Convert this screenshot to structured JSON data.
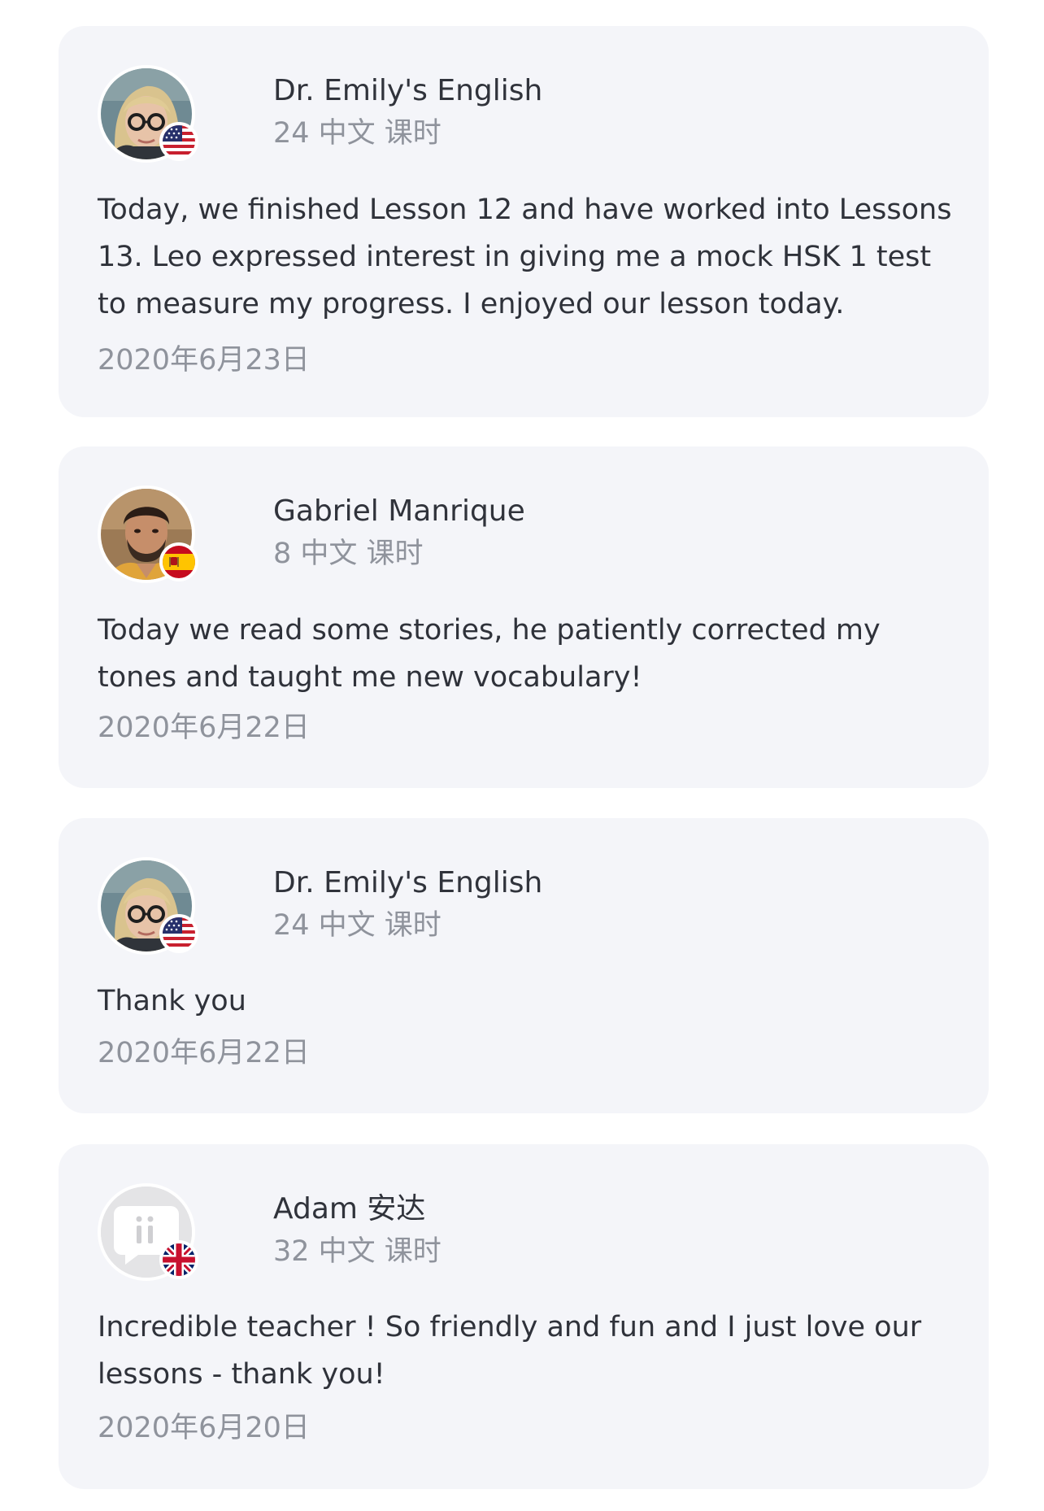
{
  "reviews": [
    {
      "author": "Dr. Emily's English",
      "lessons": "24 中文 课时",
      "text": "Today, we finished Lesson 12 and have worked into Lessons 13. Leo expressed interest in giving me a mock HSK 1 test to measure my progress. I enjoyed our lesson today.",
      "date": "2020年6月23日",
      "flag": "us-flag-icon"
    },
    {
      "author": "Gabriel Manrique",
      "lessons": "8 中文 课时",
      "text": "Today we read some stories, he patiently corrected my tones and taught me new vocabulary!",
      "date": "2020年6月22日",
      "flag": "spain-flag-icon"
    },
    {
      "author": "Dr. Emily's English",
      "lessons": "24 中文 课时",
      "text": "Thank you",
      "date": "2020年6月22日",
      "flag": "us-flag-icon"
    },
    {
      "author": "Adam 安达",
      "lessons": "32 中文 课时",
      "text": "Incredible teacher ! So friendly and fun and I just love our lessons - thank you!",
      "date": "2020年6月20日",
      "flag": "uk-flag-icon"
    }
  ],
  "colors": {
    "card_background": "#f4f5f9",
    "primary_text": "#2f323a",
    "secondary_text": "#8f939c"
  }
}
